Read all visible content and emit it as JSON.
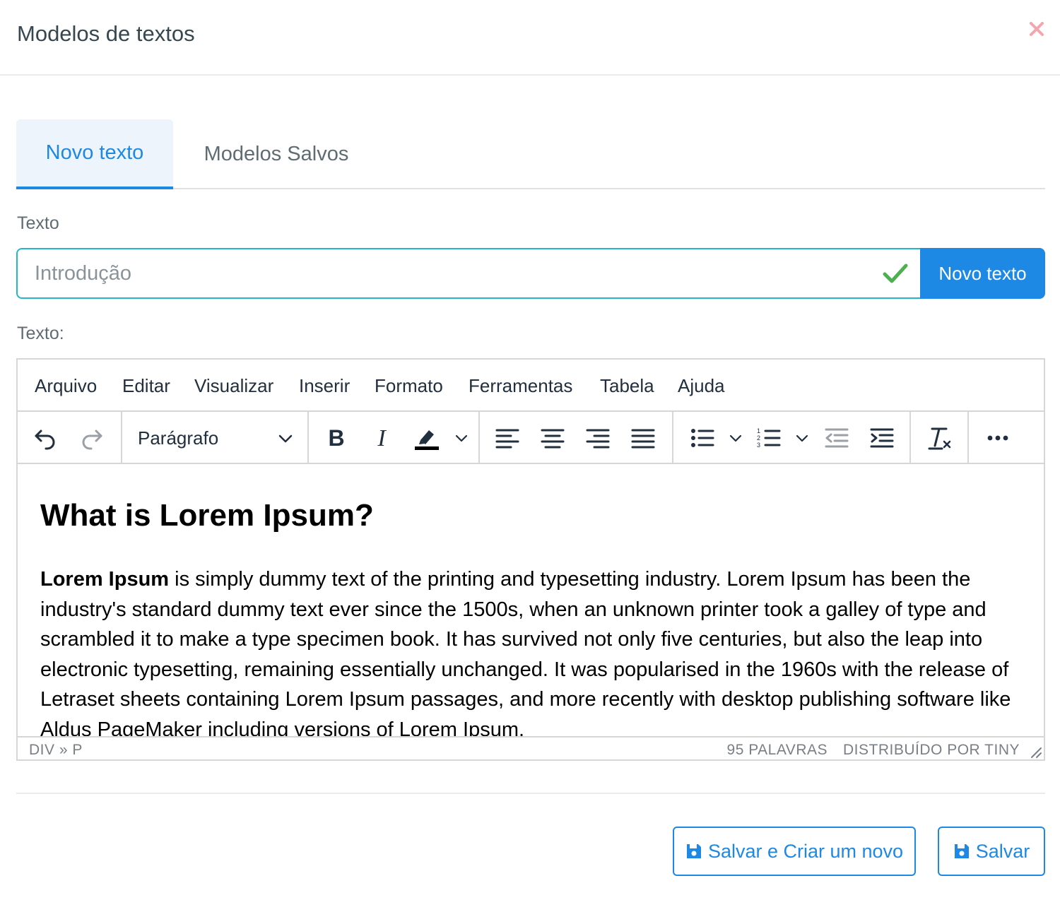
{
  "modal": {
    "title": "Modelos de textos"
  },
  "tabs": [
    {
      "label": "Novo texto",
      "active": true
    },
    {
      "label": "Modelos Salvos",
      "active": false
    }
  ],
  "form": {
    "title_label": "Texto",
    "title_placeholder": "Introdução",
    "new_text_button": "Novo texto",
    "content_label": "Texto:"
  },
  "editor": {
    "menu": [
      "Arquivo",
      "Editar",
      "Visualizar",
      "Inserir",
      "Formato",
      "Ferramentas",
      "Tabela",
      "Ajuda"
    ],
    "block_format": "Parágrafo",
    "content": {
      "heading": "What is Lorem Ipsum?",
      "paragraph_bold": "Lorem Ipsum",
      "paragraph_rest": " is simply dummy text of the printing and typesetting industry. Lorem Ipsum has been the industry's standard dummy text ever since the 1500s, when an unknown printer took a galley of type and scrambled it to make a type specimen book. It has survived not only five centuries, but also the leap into electronic typesetting, remaining essentially unchanged. It was popularised in the 1960s with the release of Letraset sheets containing Lorem Ipsum passages, and more recently with desktop publishing software like Aldus PageMaker including versions of Lorem Ipsum."
    },
    "status": {
      "path": "DIV » P",
      "word_count": "95 PALAVRAS",
      "branding": "DISTRIBUÍDO POR TINY"
    }
  },
  "footer": {
    "save_and_new": "Salvar e Criar um novo",
    "save": "Salvar"
  },
  "icons": {
    "close": "close-icon",
    "check": "check-icon",
    "save": "floppy-disk-icon"
  },
  "colors": {
    "primary": "#1e88e5",
    "close": "#f4a6ae",
    "check": "#4caf50",
    "input_border": "#26b5c8",
    "active_tab_bg": "#eef4fb"
  }
}
